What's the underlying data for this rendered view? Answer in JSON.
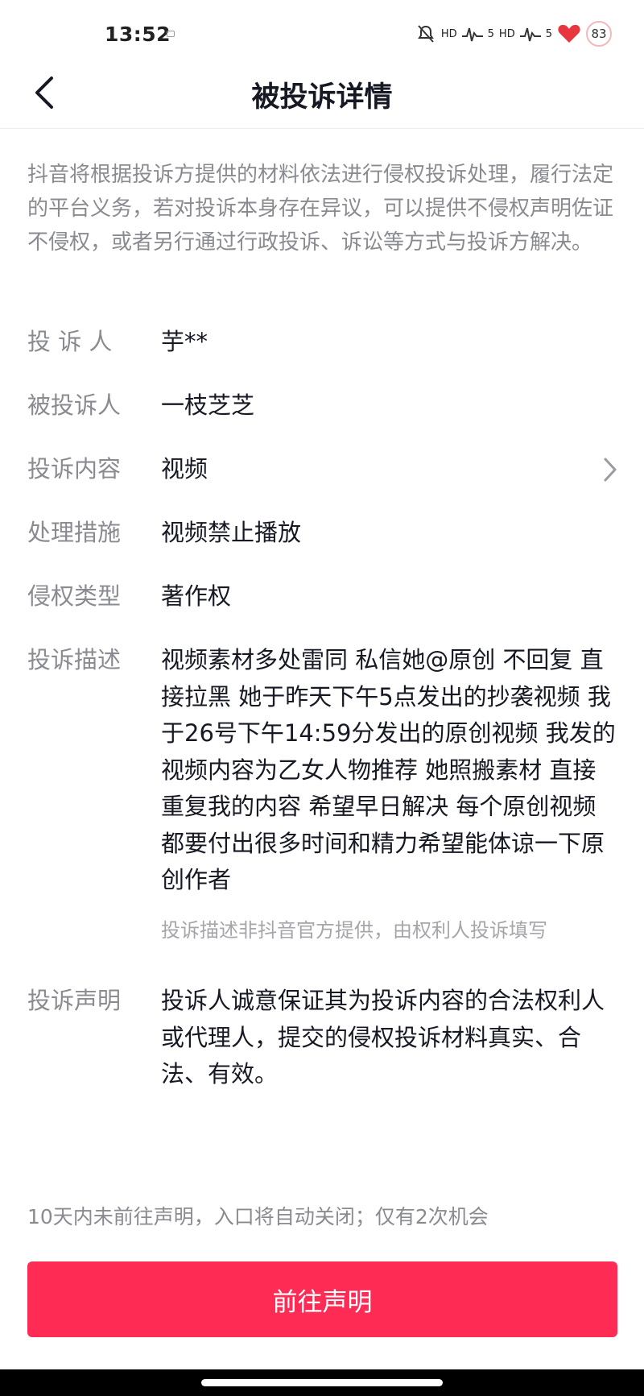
{
  "status_bar": {
    "time": "13:52",
    "network_1": "HD",
    "signal_1": "5",
    "network_2": "HD",
    "signal_2": "5",
    "battery": "83"
  },
  "header": {
    "title": "被投诉详情"
  },
  "notice": "抖音将根据投诉方提供的材料依法进行侵权投诉处理，履行法定的平台义务，若对投诉本身存在异议，可以提供不侵权声明佐证不侵权，或者另行通过行政投诉、诉讼等方式与投诉方解决。",
  "details": {
    "complainant": {
      "label": "投 诉 人",
      "value": "芋**"
    },
    "respondent": {
      "label": "被投诉人",
      "value": "一枝芝芝"
    },
    "content": {
      "label": "投诉内容",
      "value": "视频"
    },
    "measure": {
      "label": "处理措施",
      "value": "视频禁止播放"
    },
    "type": {
      "label": "侵权类型",
      "value": "著作权"
    },
    "description": {
      "label": "投诉描述",
      "value": "视频素材多处雷同 私信她@原创 不回复 直接拉黑 她于昨天下午5点发出的抄袭视频 我于26号下午14:59分发出的原创视频 我发的视频内容为乙女人物推荐 她照搬素材 直接重复我的内容 希望早日解决 每个原创视频都要付出很多时间和精力希望能体谅一下原创作者",
      "note": "投诉描述非抖音官方提供，由权利人投诉填写"
    },
    "statement": {
      "label": "投诉声明",
      "value": "投诉人诚意保证其为投诉内容的合法权利人或代理人，提交的侵权投诉材料真实、合法、有效。"
    }
  },
  "footer": {
    "deadline_text": "10天内未前往声明，入口将自动关闭；仅有2次机会",
    "button_label": "前往声明",
    "button_color": "#fe2c55"
  }
}
